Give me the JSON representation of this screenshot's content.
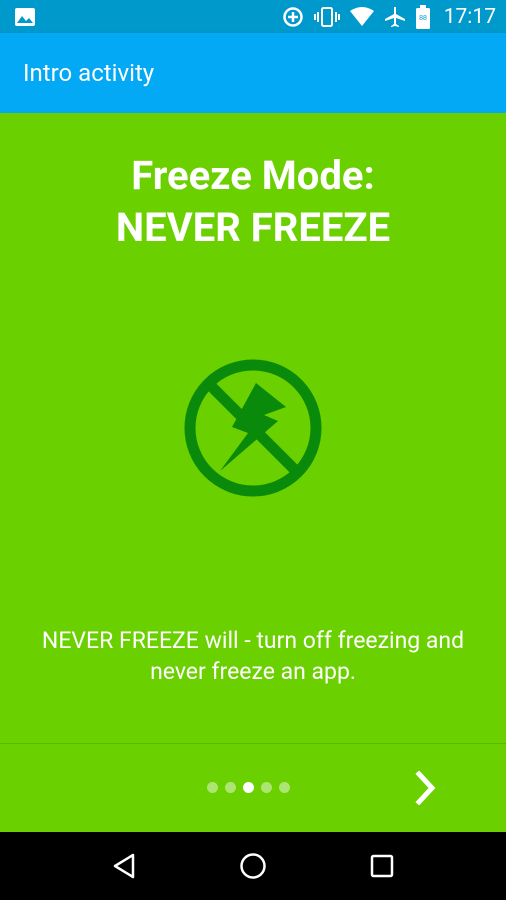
{
  "status_bar": {
    "time": "17:17",
    "icons": [
      "image-icon",
      "data-saver-icon",
      "vibrate-icon",
      "wifi-icon",
      "airplane-icon",
      "battery-icon"
    ]
  },
  "app_bar": {
    "title": "Intro activity"
  },
  "slide": {
    "title_line1": "Freeze Mode:",
    "title_line2": "NEVER FREEZE",
    "icon": "no-lightning-icon",
    "description": "NEVER FREEZE will - turn off freezing and never freeze an app.",
    "background_color": "#6ad000",
    "icon_color": "#0a8a0a"
  },
  "pager": {
    "total_pages": 5,
    "active_index": 2,
    "next_icon": "chevron-right-icon"
  },
  "nav_bar": {
    "buttons": [
      "back-icon",
      "home-icon",
      "recents-icon"
    ]
  },
  "colors": {
    "status_bar": "#0099cc",
    "app_bar": "#03a9f4",
    "text": "#ffffff"
  }
}
